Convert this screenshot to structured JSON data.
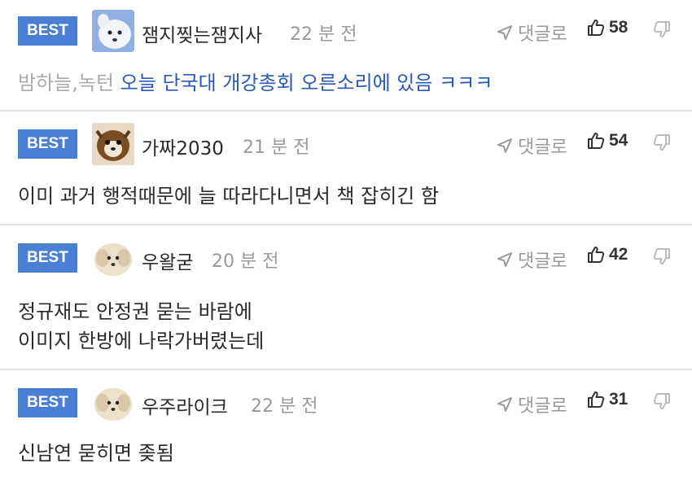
{
  "comments": [
    {
      "badge": "BEST",
      "nickname": "잼지찢는잼지사",
      "time": "22 분 전",
      "reply_label": "댓글로",
      "likes": "58",
      "mention": "밤하늘,녹턴",
      "lines": [
        "오늘 단국대 개강총회 오른소리에 있음 ㅋㅋㅋ"
      ]
    },
    {
      "badge": "BEST",
      "nickname": "가짜2030",
      "time": "21 분 전",
      "reply_label": "댓글로",
      "likes": "54",
      "lines": [
        "이미 과거 행적때문에 늘 따라다니면서 책 잡히긴 함"
      ]
    },
    {
      "badge": "BEST",
      "nickname": "우왈굳",
      "time": "20 분 전",
      "reply_label": "댓글로",
      "likes": "42",
      "lines": [
        "정규재도 안정권 묻는 바람에",
        "이미지 한방에 나락가버렸는데"
      ]
    },
    {
      "badge": "BEST",
      "nickname": "우주라이크",
      "time": "22 분 전",
      "reply_label": "댓글로",
      "likes": "31",
      "lines": [
        "신남연 묻히면 좆됨"
      ]
    }
  ]
}
